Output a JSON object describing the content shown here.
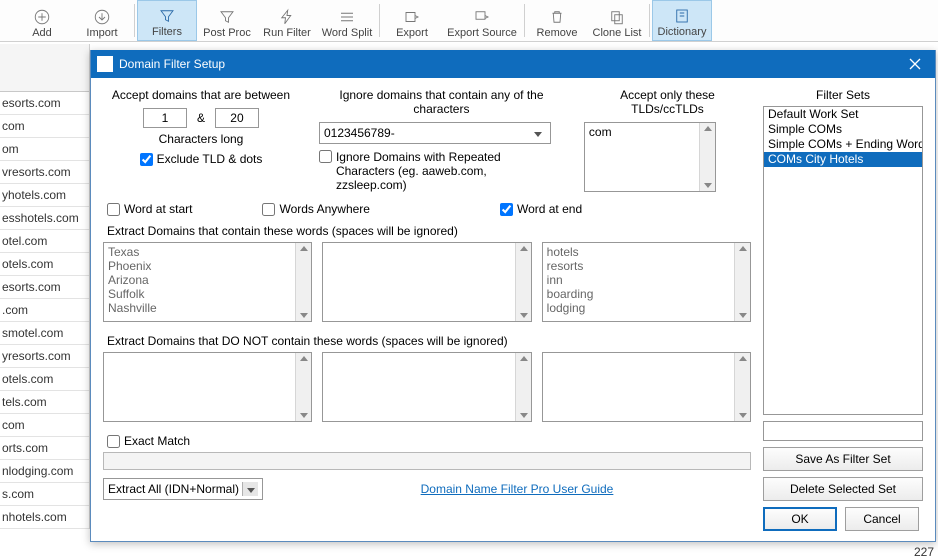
{
  "toolbar": {
    "items": [
      {
        "label": "Add"
      },
      {
        "label": "Import"
      },
      {
        "label": "Filters",
        "active": true
      },
      {
        "label": "Post Proc"
      },
      {
        "label": "Run Filter"
      },
      {
        "label": "Word Split"
      },
      {
        "label": "Export"
      },
      {
        "label": "Export Source"
      },
      {
        "label": "Remove"
      },
      {
        "label": "Clone List"
      },
      {
        "label": "Dictionary",
        "active": true
      }
    ]
  },
  "bg_domains": [
    "",
    "esorts.com",
    "com",
    "om",
    "vresorts.com",
    "yhotels.com",
    "esshotels.com",
    "otel.com",
    "otels.com",
    "esorts.com",
    ".com",
    "smotel.com",
    "yresorts.com",
    "otels.com",
    "tels.com",
    "com",
    "orts.com",
    "nlodging.com",
    "s.com",
    "nhotels.com"
  ],
  "dialog": {
    "title": "Domain Filter Setup",
    "accept_between_label": "Accept domains that are between",
    "min": "1",
    "amp": "&",
    "max": "20",
    "chars_long": "Characters long",
    "exclude_tld": "Exclude TLD & dots",
    "ignore_chars_label": "Ignore domains that contain any of the characters",
    "ignore_chars_value": "0123456789-",
    "ignore_repeated": "Ignore Domains with Repeated Characters (eg. aaweb.com, zzsleep.com)",
    "accept_tlds_label": "Accept only these TLDs/ccTLDs",
    "accept_tlds_value": "com",
    "word_start": "Word at start",
    "words_anywhere": "Words Anywhere",
    "word_end": "Word at end",
    "contain_label": "Extract Domains that contain these words (spaces will be ignored)",
    "contain_left": "Texas\nPhoenix\nArizona\nSuffolk\nNashville",
    "contain_right": "hotels\nresorts\ninn\nboarding\nlodging",
    "notcontain_label": "Extract Domains that DO NOT contain these words (spaces will be ignored)",
    "exact_match": "Exact Match",
    "extract_mode": "Extract All (IDN+Normal)",
    "guide_link": "Domain Name Filter Pro User Guide",
    "ok": "OK",
    "cancel": "Cancel"
  },
  "filter_sets": {
    "title": "Filter Sets",
    "items": [
      "Default Work Set",
      "Simple COMs",
      "Simple COMs + Ending Words",
      "COMs City Hotels"
    ],
    "selected": "COMs City Hotels",
    "save": "Save As Filter Set",
    "delete": "Delete Selected Set"
  },
  "counter": "227"
}
